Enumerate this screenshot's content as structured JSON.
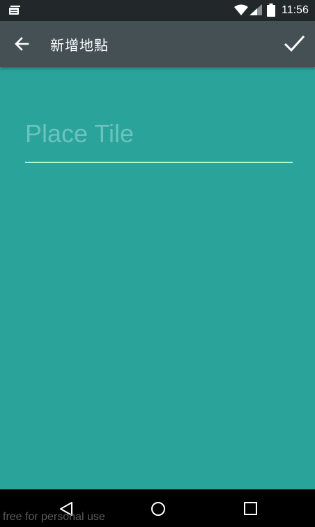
{
  "status_bar": {
    "time": "11:56",
    "icons": [
      "notification-icon",
      "wifi-icon",
      "signal-icon",
      "battery-icon"
    ]
  },
  "app_bar": {
    "title": "新增地點",
    "back_icon": "arrow-left-icon",
    "confirm_icon": "check-icon",
    "background": "#455055"
  },
  "form": {
    "place_title_placeholder": "Place Tile",
    "place_title_value": "",
    "background": "#2aa39b",
    "underline_color": "#a8ffd0"
  },
  "nav_bar": {
    "icons": [
      "nav-back-icon",
      "nav-home-icon",
      "nav-recent-apps-icon"
    ]
  },
  "watermark": "free for personal use"
}
